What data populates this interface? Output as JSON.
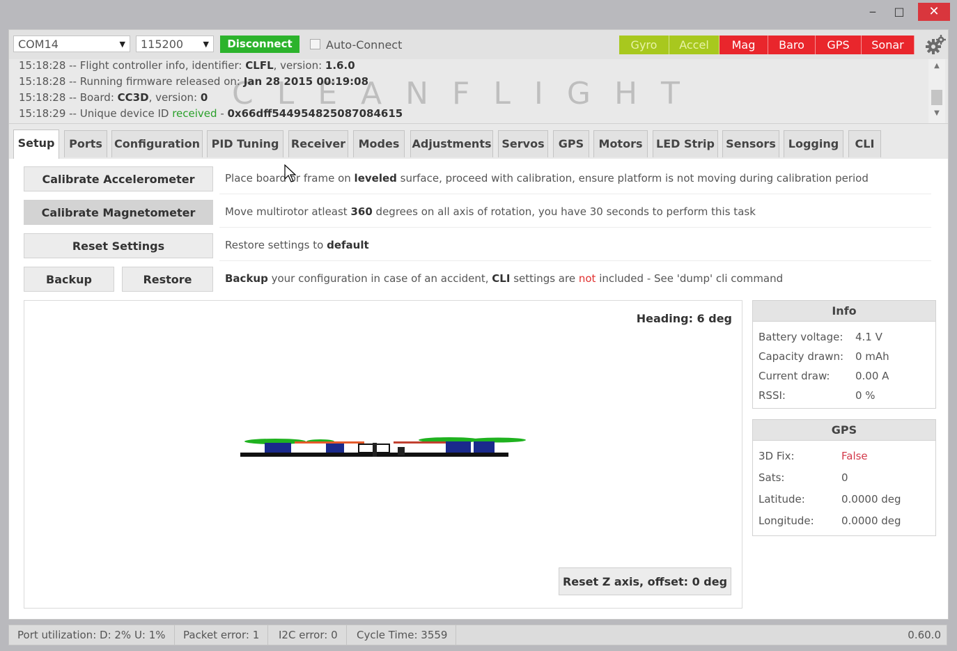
{
  "window": {
    "minimize": "‒",
    "maximize": "□",
    "close": "✕"
  },
  "header": {
    "port": "COM14",
    "baud": "115200",
    "disconnect_label": "Disconnect",
    "autoconnect_label": "Auto-Connect",
    "sensors": [
      {
        "label": "Gyro",
        "color": "#a8c81e"
      },
      {
        "label": "Accel",
        "color": "#a8c81e"
      },
      {
        "label": "Mag",
        "color": "#e9262c"
      },
      {
        "label": "Baro",
        "color": "#e9262c"
      },
      {
        "label": "GPS",
        "color": "#e9262c"
      },
      {
        "label": "Sonar",
        "color": "#e9262c"
      }
    ]
  },
  "log": {
    "lines": [
      {
        "time": "15:18:28",
        "text": " -- Flight controller info, identifier: ",
        "bold1": "CLFL",
        "mid": ", version: ",
        "bold2": "1.6.0"
      },
      {
        "time": "15:18:28",
        "text": " -- Running firmware released on: ",
        "bold1": "Jan 28 2015 00:19:08"
      },
      {
        "time": "15:18:28",
        "text": " -- Board: ",
        "bold1": "CC3D",
        "mid": ", version: ",
        "bold2": "0"
      },
      {
        "time": "15:18:29",
        "text": " -- Unique device ID ",
        "green": "received",
        "mid": " - ",
        "bold2": "0x66dff544954825087084615"
      }
    ],
    "watermark": "CLEANFLIGHT"
  },
  "tabs": [
    "Setup",
    "Ports",
    "Configuration",
    "PID Tuning",
    "Receiver",
    "Modes",
    "Adjustments",
    "Servos",
    "GPS",
    "Motors",
    "LED Strip",
    "Sensors",
    "Logging",
    "CLI"
  ],
  "setup": {
    "calibrate_acc": "Calibrate Accelerometer",
    "calibrate_acc_desc_a": "Place board or frame on ",
    "calibrate_acc_desc_b": "leveled",
    "calibrate_acc_desc_c": " surface, proceed with calibration, ensure platform is not moving during calibration period",
    "calibrate_mag": "Calibrate Magnetometer",
    "calibrate_mag_desc_a": "Move multirotor atleast ",
    "calibrate_mag_desc_b": "360",
    "calibrate_mag_desc_c": " degrees on all axis of rotation, you have 30 seconds to perform this task",
    "reset_settings": "Reset Settings",
    "reset_desc_a": "Restore settings to ",
    "reset_desc_b": "default",
    "backup": "Backup",
    "restore": "Restore",
    "backup_desc_a": "Backup",
    "backup_desc_b": " your configuration in case of an accident, ",
    "backup_desc_c": "CLI",
    "backup_desc_d": " settings are ",
    "backup_desc_e": "not",
    "backup_desc_f": " included - See 'dump' cli command",
    "heading": "Heading: 6 deg",
    "reset_z": "Reset Z axis, offset: 0 deg"
  },
  "info": {
    "title": "Info",
    "rows": [
      {
        "label": "Battery voltage:",
        "value": "4.1 V"
      },
      {
        "label": "Capacity drawn:",
        "value": "0 mAh"
      },
      {
        "label": "Current draw:",
        "value": "0.00 A"
      },
      {
        "label": "RSSI:",
        "value": "0 %"
      }
    ]
  },
  "gps": {
    "title": "GPS",
    "rows": [
      {
        "label": "3D Fix:",
        "value": "False"
      },
      {
        "label": "Sats:",
        "value": "0"
      },
      {
        "label": "Latitude:",
        "value": "0.0000 deg"
      },
      {
        "label": "Longitude:",
        "value": "0.0000 deg"
      }
    ]
  },
  "status": {
    "port_util": "Port utilization: D: 2% U: 1%",
    "packet_error": "Packet error: 1",
    "i2c_error": "I2C error: 0",
    "cycle_time": "Cycle Time: 3559",
    "version": "0.60.0"
  }
}
